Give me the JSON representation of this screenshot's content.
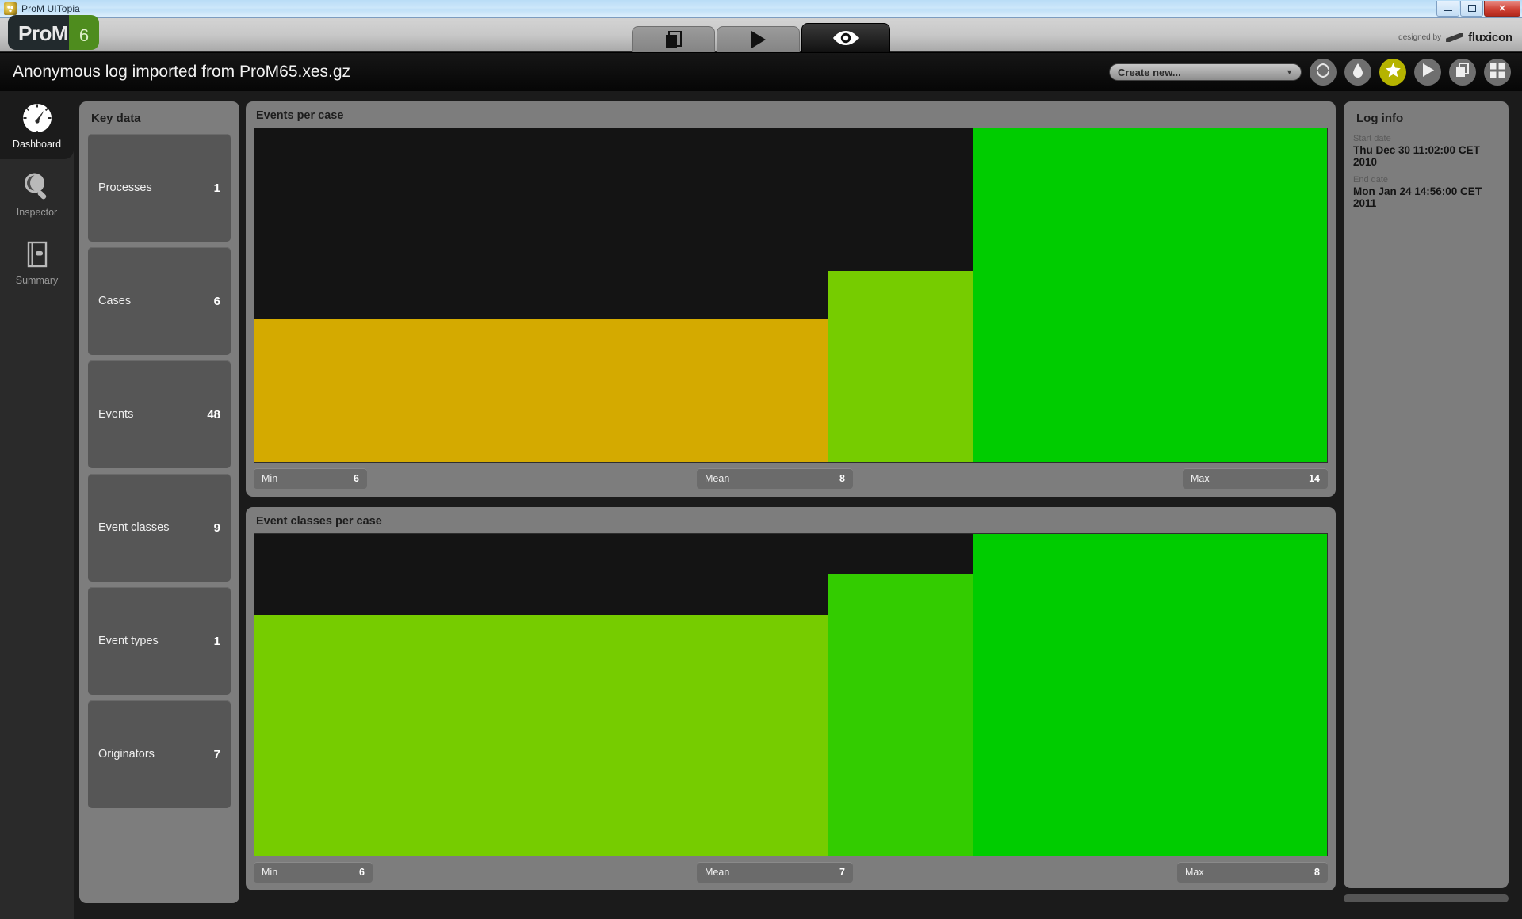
{
  "os_window": {
    "title": "ProM UITopia",
    "app_icon": "prom-app-icon",
    "minimize_label": "Minimize",
    "maximize_label": "Restore",
    "close_label": "Close"
  },
  "chrome": {
    "logo_text": "ProM",
    "logo_version": "6",
    "credit_prefix": "designed by",
    "credit_brand": "fluxicon",
    "tabs": [
      {
        "id": "workspace",
        "icon": "copy-icon",
        "label": "Workspace",
        "active": false
      },
      {
        "id": "actions",
        "icon": "play-icon",
        "label": "Actions",
        "active": false
      },
      {
        "id": "views",
        "icon": "eye-icon",
        "label": "Views",
        "active": true
      }
    ]
  },
  "header": {
    "document_title": "Anonymous log imported from ProM65.xes.gz",
    "create_new": {
      "label": "Create new...",
      "caret": "▼"
    },
    "buttons": [
      {
        "id": "refresh",
        "icon": "resources-icon",
        "accent": false
      },
      {
        "id": "drop",
        "icon": "droplet-icon",
        "accent": false
      },
      {
        "id": "favorites",
        "icon": "star-icon",
        "accent": true
      },
      {
        "id": "run",
        "icon": "play-icon",
        "accent": false
      },
      {
        "id": "copies",
        "icon": "copy-icon",
        "accent": false
      },
      {
        "id": "grid",
        "icon": "grid-icon",
        "accent": false
      }
    ],
    "accent_color": "#b5b300"
  },
  "sidebar": {
    "items": [
      {
        "id": "dashboard",
        "label": "Dashboard",
        "icon": "gauge-icon",
        "active": true
      },
      {
        "id": "inspector",
        "label": "Inspector",
        "icon": "magnifier-icon",
        "active": false
      },
      {
        "id": "summary",
        "label": "Summary",
        "icon": "book-icon",
        "active": false
      }
    ]
  },
  "key_data": {
    "title": "Key data",
    "cards": [
      {
        "label": "Processes",
        "value": "1"
      },
      {
        "label": "Cases",
        "value": "6"
      },
      {
        "label": "Events",
        "value": "48"
      },
      {
        "label": "Event classes",
        "value": "9"
      },
      {
        "label": "Event types",
        "value": "1"
      },
      {
        "label": "Originators",
        "value": "7"
      }
    ]
  },
  "log_info": {
    "title": "Log info",
    "start_label": "Start date",
    "start_value": "Thu Dec 30 11:02:00 CET 2010",
    "end_label": "End date",
    "end_value": "Mon Jan 24 14:56:00 CET 2011"
  },
  "charts": [
    {
      "title": "Events per case",
      "stats": [
        {
          "label": "Min",
          "value": "6"
        },
        {
          "label": "Mean",
          "value": "8"
        },
        {
          "label": "Max",
          "value": "14"
        }
      ]
    },
    {
      "title": "Event classes per case",
      "stats": [
        {
          "label": "Min",
          "value": "6"
        },
        {
          "label": "Mean",
          "value": "7"
        },
        {
          "label": "Max",
          "value": "8"
        }
      ]
    }
  ],
  "chart_data": [
    {
      "type": "bar",
      "title": "Events per case",
      "categories": [
        "Min",
        "Mean",
        "Max"
      ],
      "values": [
        6,
        8,
        14
      ],
      "colors": [
        "#d4aa00",
        "#76cc00",
        "#00cc00"
      ],
      "xlabel": "",
      "ylabel": "Events per case",
      "ylim": [
        0,
        14
      ],
      "grid": false,
      "legend": "none",
      "background": "#141414",
      "orientation": "vertical",
      "bar_widths_fraction": [
        0.535,
        0.135,
        0.33
      ]
    },
    {
      "type": "bar",
      "title": "Event classes per case",
      "categories": [
        "Min",
        "Mean",
        "Max"
      ],
      "values": [
        6,
        7,
        8
      ],
      "colors": [
        "#76cc00",
        "#33cc00",
        "#00cc00"
      ],
      "xlabel": "",
      "ylabel": "Event classes per case",
      "ylim": [
        0,
        8
      ],
      "grid": false,
      "legend": "none",
      "background": "#141414",
      "orientation": "vertical",
      "bar_widths_fraction": [
        0.535,
        0.135,
        0.33
      ]
    }
  ]
}
